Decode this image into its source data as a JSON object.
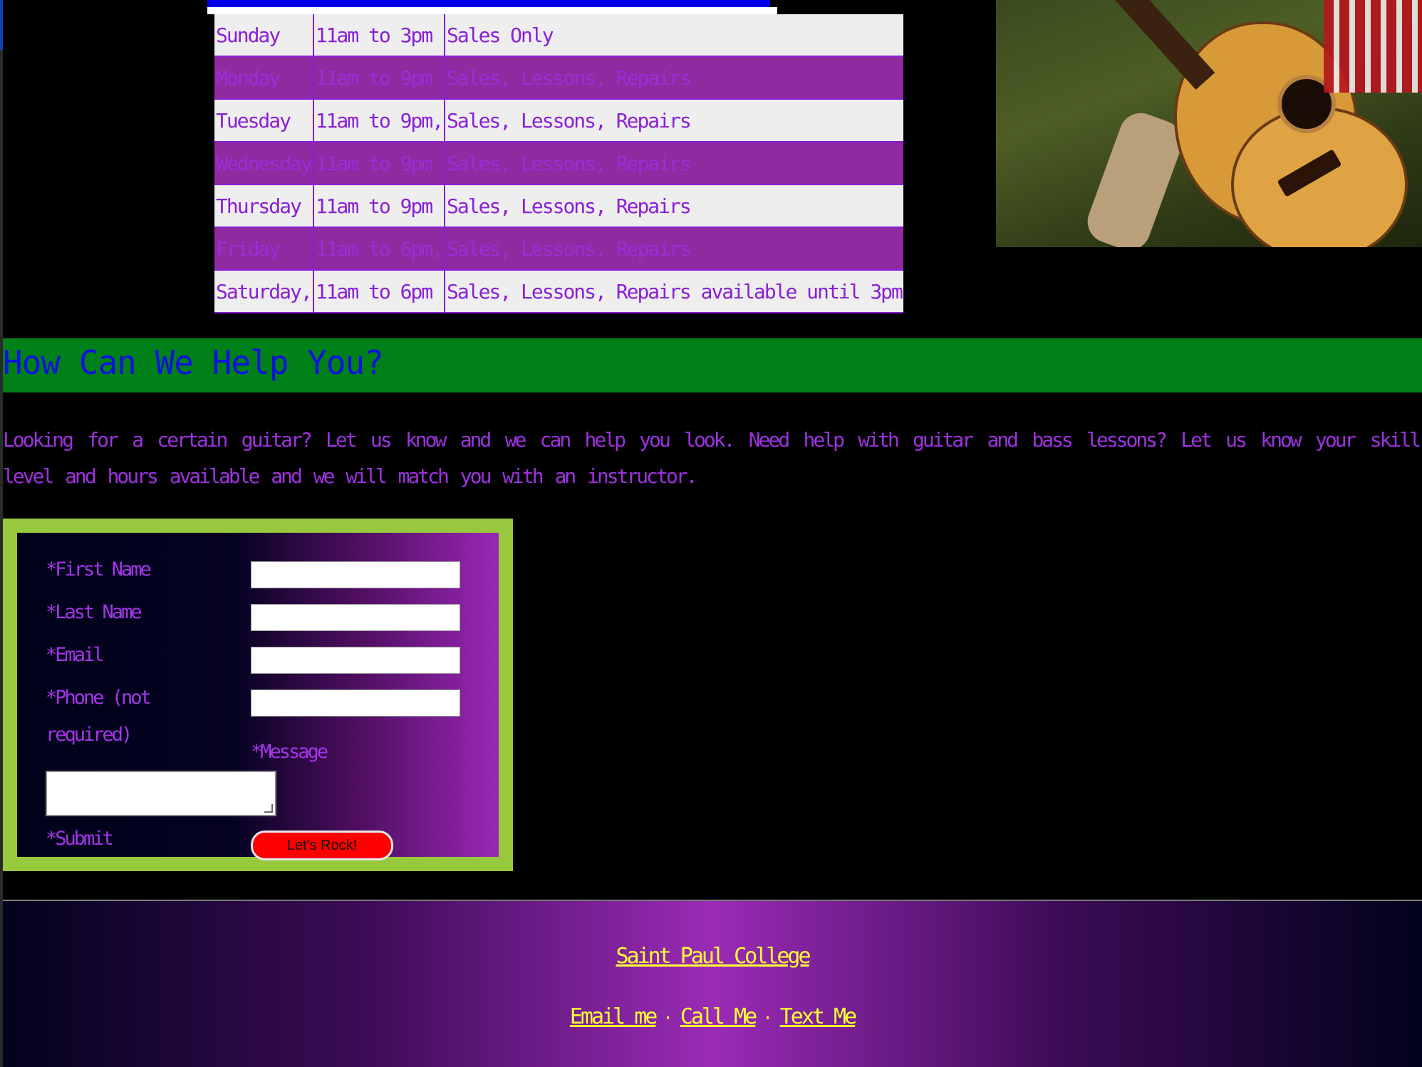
{
  "hours": {
    "rows": [
      {
        "day": "Sunday",
        "time": "11am to 3pm",
        "services": "Sales Only",
        "shade": "light"
      },
      {
        "day": "Monday",
        "time": "11am to 9pm",
        "services": "Sales, Lessons, Repairs",
        "shade": "dark"
      },
      {
        "day": "Tuesday",
        "time": "11am to 9pm,",
        "services": "Sales, Lessons, Repairs",
        "shade": "light"
      },
      {
        "day": "Wednesday",
        "time": "11am to 9pm",
        "services": "Sales, Lessons, Repairs",
        "shade": "dark"
      },
      {
        "day": "Thursday",
        "time": "11am to 9pm",
        "services": "Sales, Lessons, Repairs",
        "shade": "light"
      },
      {
        "day": "Friday",
        "time": "11am to 6pm,",
        "services": "Sales, Lessons, Repairs",
        "shade": "dark"
      },
      {
        "day": "Saturday,",
        "time": "11am to 6pm",
        "services": "Sales, Lessons, Repairs available until 3pm",
        "shade": "light"
      }
    ]
  },
  "help": {
    "title": "How Can We Help You?",
    "text": "Looking for a certain guitar? Let us know and we can help you look. Need help with guitar and bass lessons? Let us know your skill level and hours available and we will match you with an instructor."
  },
  "form": {
    "first_name_label": "*First Name",
    "last_name_label": "*Last Name",
    "email_label": "*Email",
    "phone_label": "*Phone (not required)",
    "message_label": "*Message",
    "submit_label": "*Submit",
    "submit_button": "Let's Rock!",
    "first_name_value": "",
    "last_name_value": "",
    "email_value": "",
    "phone_value": "",
    "message_value": ""
  },
  "footer": {
    "college_link": "Saint Paul College",
    "email_link": "Email me",
    "call_link": "Call Me",
    "text_link": "Text Me",
    "separator": "·"
  },
  "colors": {
    "accent_purple": "#9d32e0",
    "help_bar_green": "#008018",
    "form_border_green": "#97c83e",
    "footer_link_yellow": "#ffff33",
    "submit_red": "#ff0000"
  }
}
